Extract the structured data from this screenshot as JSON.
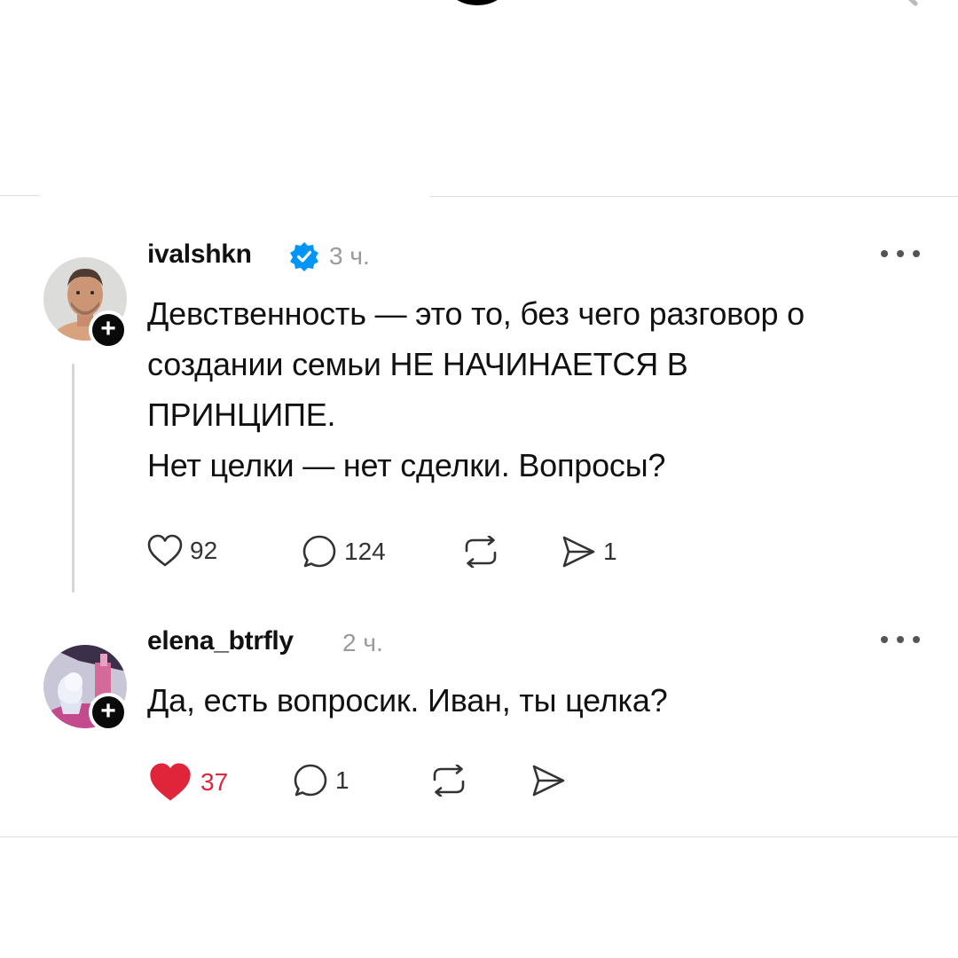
{
  "header": {
    "logo_icon": "threads-logo-icon",
    "search_icon": "search-icon"
  },
  "posts": [
    {
      "username": "ivalshkn",
      "verified": true,
      "time": "3 ч.",
      "text_lines": [
        "Девственность — это то, без чего разговор о",
        "создании семьи НЕ НАЧИНАЕТСЯ В",
        "ПРИНЦИПЕ.",
        "Нет целки — нет сделки. Вопросы?"
      ],
      "likes": "92",
      "liked": false,
      "replies": "124",
      "reposts": "",
      "shares": "1"
    },
    {
      "username": "elena_btrfly",
      "verified": false,
      "time": "2 ч.",
      "text_lines": [
        "Да, есть вопросик. Иван, ты целка?"
      ],
      "likes": "37",
      "liked": true,
      "replies": "1",
      "reposts": "",
      "shares": ""
    }
  ],
  "colors": {
    "like_active": "#e0243a",
    "verified_blue": "#0095f6",
    "timestamp_gray": "#9a9a9a",
    "divider": "#dcdcdc"
  }
}
